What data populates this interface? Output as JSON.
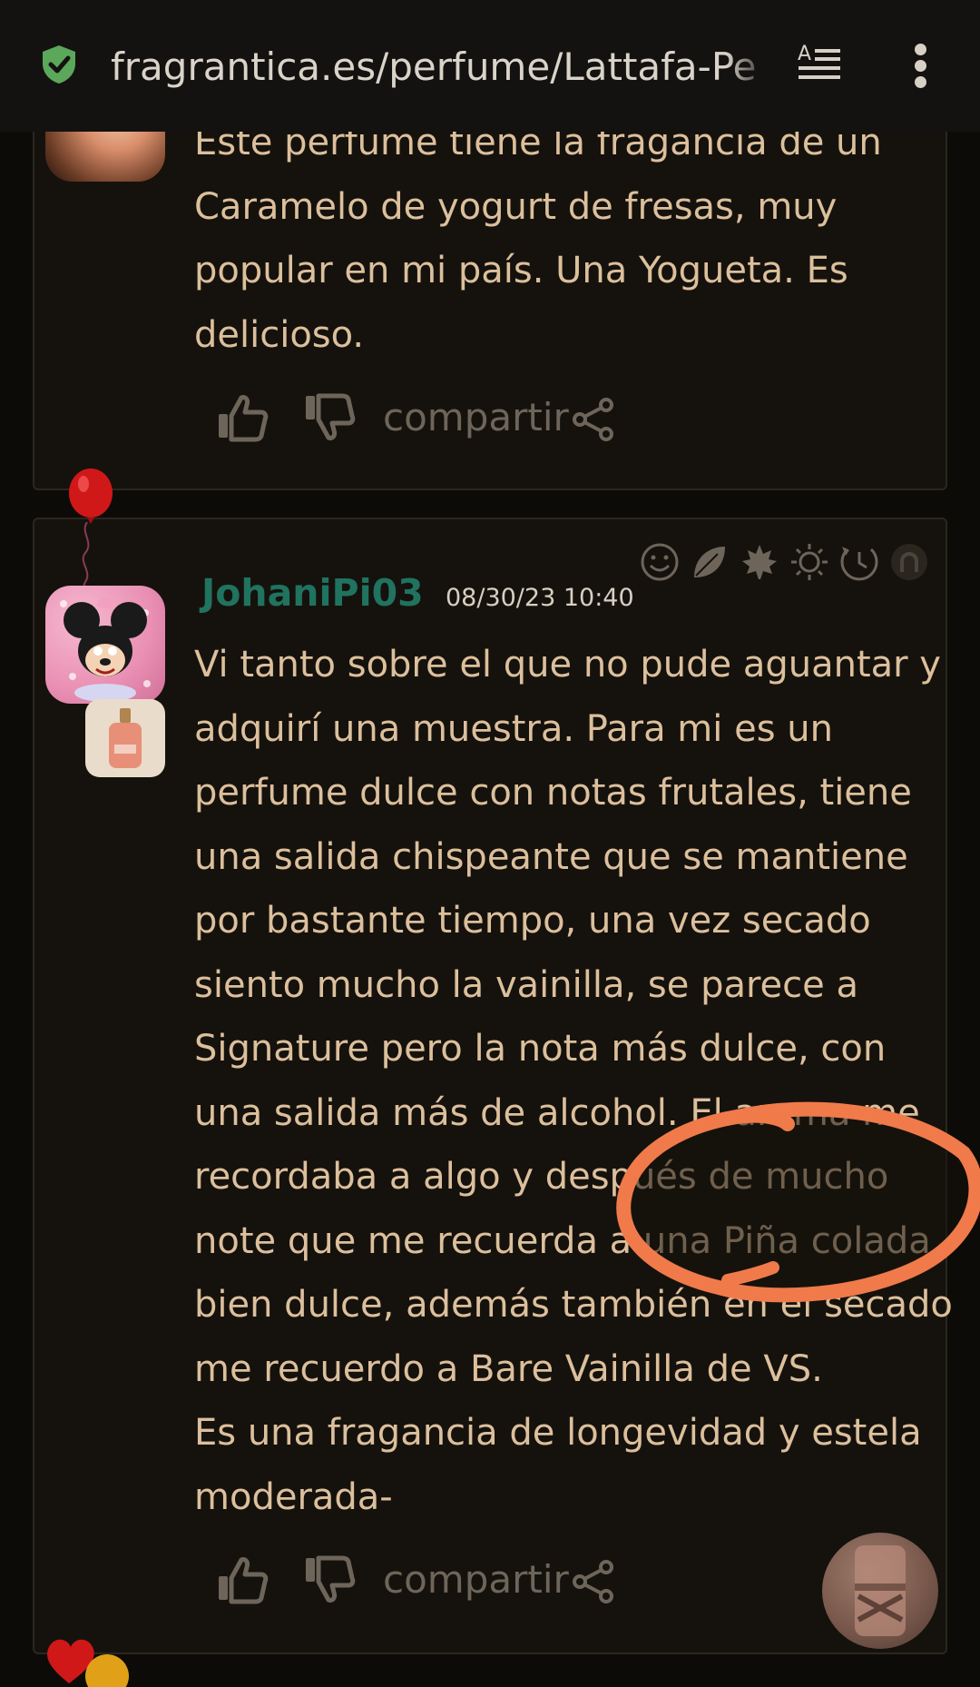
{
  "browser": {
    "url": "fragrantica.es/perfume/Lattafa-Pe",
    "colors": {
      "shield": "#5ca85a",
      "bar": "#141210"
    }
  },
  "reviews": [
    {
      "lines": [
        "Este perfume tiene la fragancia de un",
        "Caramelo de yogurt de fresas, muy",
        "popular en mi país. Una Yogueta. Es",
        "delicioso."
      ],
      "share_label": "compartir"
    },
    {
      "username": "JohaniPi03",
      "date": "08/30/23 10:40",
      "season_icons": [
        "smile-icon",
        "leaf-icon",
        "maple-leaf-icon",
        "sun-icon",
        "clock-icon",
        "moon-icon"
      ],
      "lines": [
        "Vi tanto sobre el que no pude aguantar y",
        "adquirí una muestra. Para mi es un",
        "perfume dulce con notas frutales, tiene",
        "una salida chispeante que se mantiene",
        "por bastante tiempo, una vez secado",
        "siento mucho la vainilla, se parece a",
        "Signature pero la nota más dulce, con",
        "una salida más de alcohol. El aroma me",
        "recordaba a algo y después de mucho",
        "note que me recuerda a una Piña colada",
        "bien dulce, además también en el secado",
        "me recuerdo a Bare Vainilla de VS.",
        "Es una fragancia de longevidad y estela",
        "moderada-"
      ],
      "share_label": "compartir"
    }
  ],
  "colors": {
    "text": "#dcbf9c",
    "username": "#20735f",
    "annotation": "#f07a4a"
  }
}
